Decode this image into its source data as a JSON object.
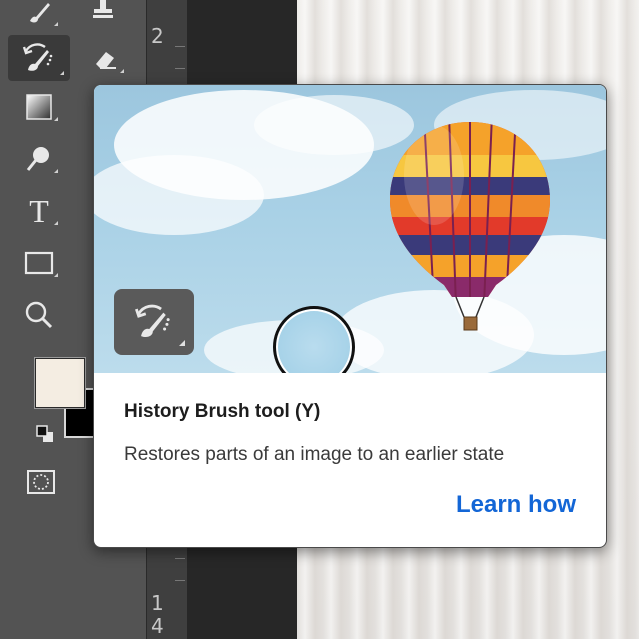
{
  "toolbar": {
    "tools": [
      {
        "name": "brush-icon"
      },
      {
        "name": "clone-stamp-icon"
      },
      {
        "name": "history-brush-icon",
        "selected": true
      },
      {
        "name": "eraser-icon"
      },
      {
        "name": "gradient-icon"
      },
      {
        "name": "dodge-icon"
      },
      {
        "name": "type-icon",
        "label": "T"
      },
      {
        "name": "rectangle-icon"
      },
      {
        "name": "zoom-icon"
      },
      {
        "name": "quick-mask-icon"
      }
    ],
    "foreground_color": "#f4ede2",
    "background_color": "#000000"
  },
  "ruler": {
    "labels": [
      "2",
      "1",
      "4"
    ]
  },
  "tooltip": {
    "title": "History Brush tool (Y)",
    "description": "Restores parts of an image to an earlier state",
    "link_label": "Learn how",
    "link_color": "#1366d6"
  }
}
